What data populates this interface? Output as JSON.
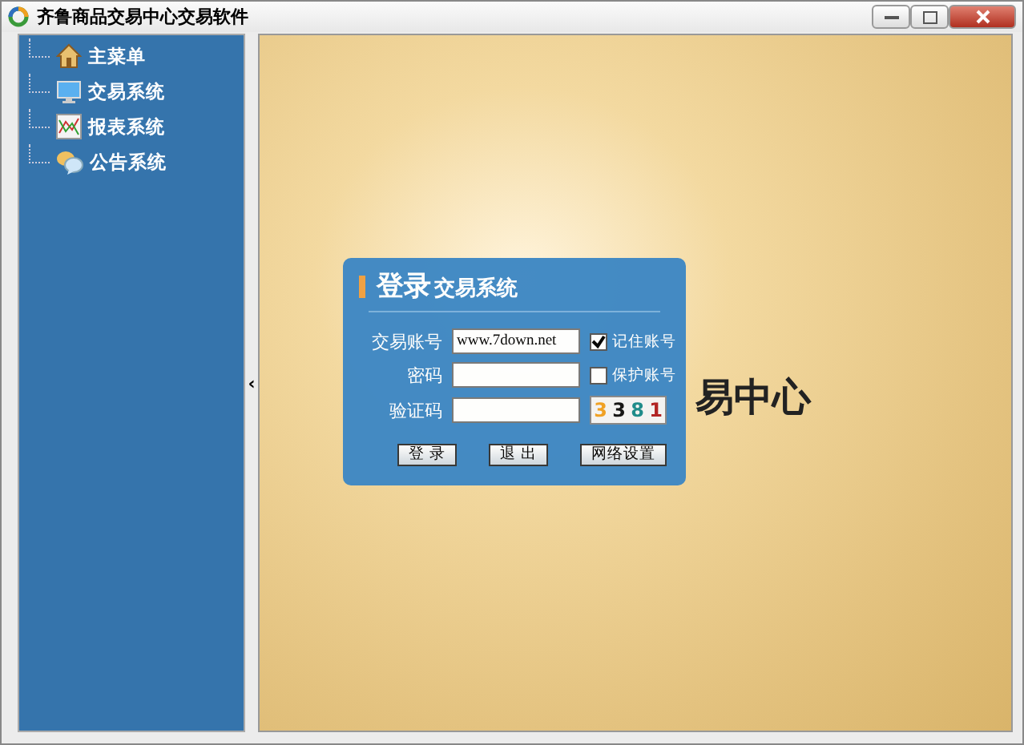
{
  "window": {
    "title": "齐鲁商品交易中心交易软件"
  },
  "sidebar": {
    "items": [
      {
        "kind": "home",
        "label": "主菜单"
      },
      {
        "kind": "monitor",
        "label": "交易系统"
      },
      {
        "kind": "chart",
        "label": "报表系统"
      },
      {
        "kind": "chat",
        "label": "公告系统"
      }
    ]
  },
  "splitter": {
    "arrow": "‹"
  },
  "background": {
    "text": "易中心"
  },
  "login": {
    "title_big": "登录",
    "title_small": "交易系统",
    "fields": [
      {
        "label": "交易账号",
        "value": "www.7down.net"
      },
      {
        "label": "密码"
      },
      {
        "label": "验证码"
      }
    ],
    "options": [
      {
        "label": "记住账号",
        "checked": true
      },
      {
        "label": "保护账号",
        "checked": false
      }
    ],
    "captcha": "3381",
    "buttons": [
      "登 录",
      "退 出",
      "网络设置"
    ]
  }
}
